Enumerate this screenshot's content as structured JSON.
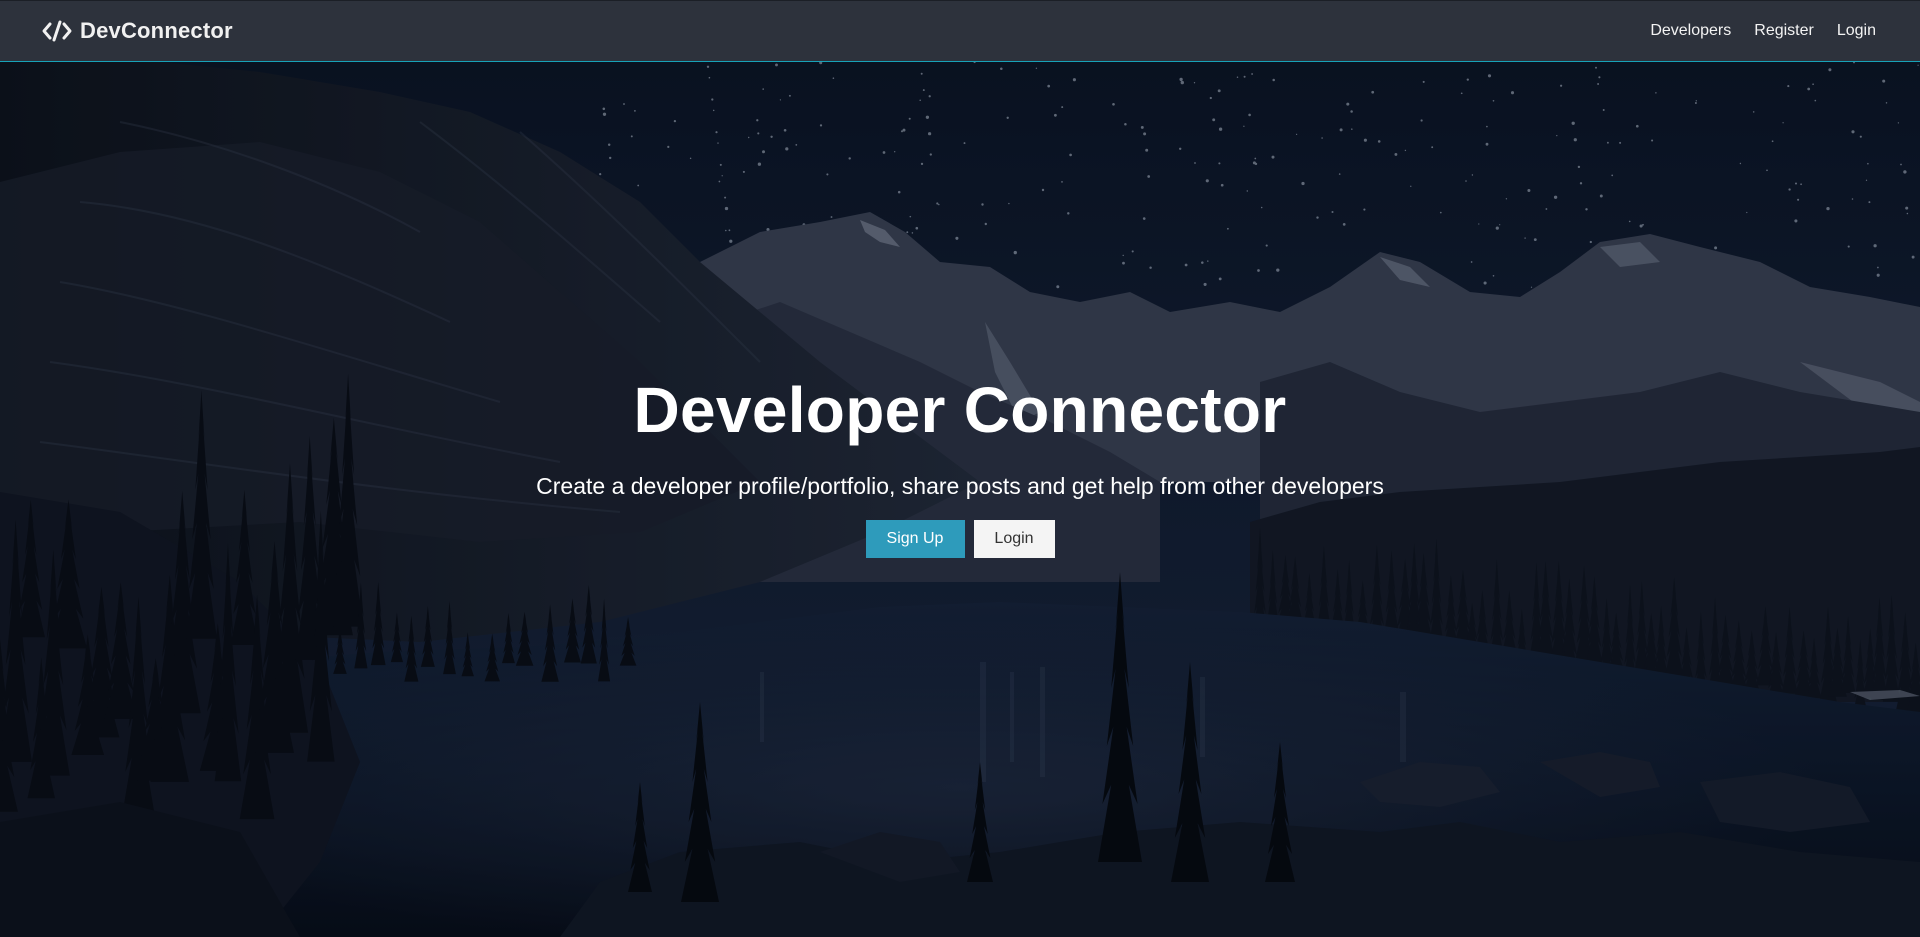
{
  "navbar": {
    "brand_text": "DevConnector",
    "brand_icon": "code-icon",
    "links": [
      "Developers",
      "Register",
      "Login"
    ]
  },
  "hero": {
    "title": "Developer Connector",
    "lead": "Create a developer profile/portfolio, share posts and get help from other developers",
    "buttons": {
      "primary": "Sign Up",
      "secondary": "Login"
    }
  },
  "colors": {
    "navbar_bg": "#2d323c",
    "accent": "#17a2b8",
    "primary_button": "#2e9bbb",
    "light_button": "#f4f4f4"
  }
}
